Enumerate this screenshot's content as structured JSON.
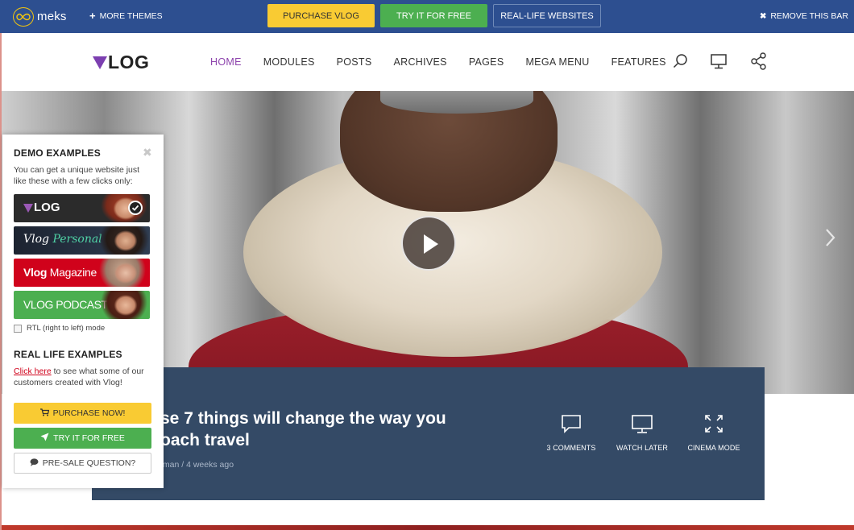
{
  "topbar": {
    "brand": "meks",
    "more_themes": "MORE THEMES",
    "purchase": "PURCHASE VLOG",
    "try_free": "TRY IT FOR FREE",
    "real_life": "REAL-LIFE WEBSITES",
    "remove_bar": "REMOVE THIS BAR",
    "colors": {
      "bar": "#2d4f90",
      "yellow": "#f9cb33",
      "green": "#4caf50"
    }
  },
  "header": {
    "logo": "LOG",
    "nav": [
      "HOME",
      "MODULES",
      "POSTS",
      "ARCHIVES",
      "PAGES",
      "MEGA MENU",
      "FEATURES"
    ],
    "active_nav": "HOME",
    "icons": [
      "search-icon",
      "monitor-icon",
      "share-icon"
    ],
    "accent": "#8e44ad"
  },
  "hero": {
    "play_icon": "play-icon",
    "next_icon": "chevron-right-icon"
  },
  "post": {
    "title": "se 7 things will change the way you\noach travel",
    "meta": "fman / 4 weeks ago",
    "actions": [
      {
        "icon": "comment-icon",
        "label": "3 COMMENTS"
      },
      {
        "icon": "monitor-icon",
        "label": "WATCH LATER"
      },
      {
        "icon": "expand-icon",
        "label": "CINEMA MODE"
      }
    ],
    "panel_color": "#344a66"
  },
  "demo": {
    "heading": "DEMO EXAMPLES",
    "intro": "You can get a unique website just like these with a few clicks only:",
    "thumbs": [
      {
        "label": "LOG",
        "color": "#2b2b2b",
        "selected": true
      },
      {
        "label": "Vlog Personal",
        "color": "#1f2a3a",
        "selected": false
      },
      {
        "label": "Vlog Magazine",
        "color": "#d0021b",
        "selected": false
      },
      {
        "label": "VLOG PODCAST",
        "color": "#4caf50",
        "selected": false
      }
    ],
    "rtl_label": "RTL (right to left) mode",
    "real_heading": "REAL LIFE EXAMPLES",
    "click_here": "Click here",
    "real_text": " to see what some of our customers created with Vlog!",
    "buy_label": "PURCHASE NOW!",
    "try_label": "TRY IT FOR FREE",
    "ask_label": "PRE-SALE QUESTION?"
  }
}
